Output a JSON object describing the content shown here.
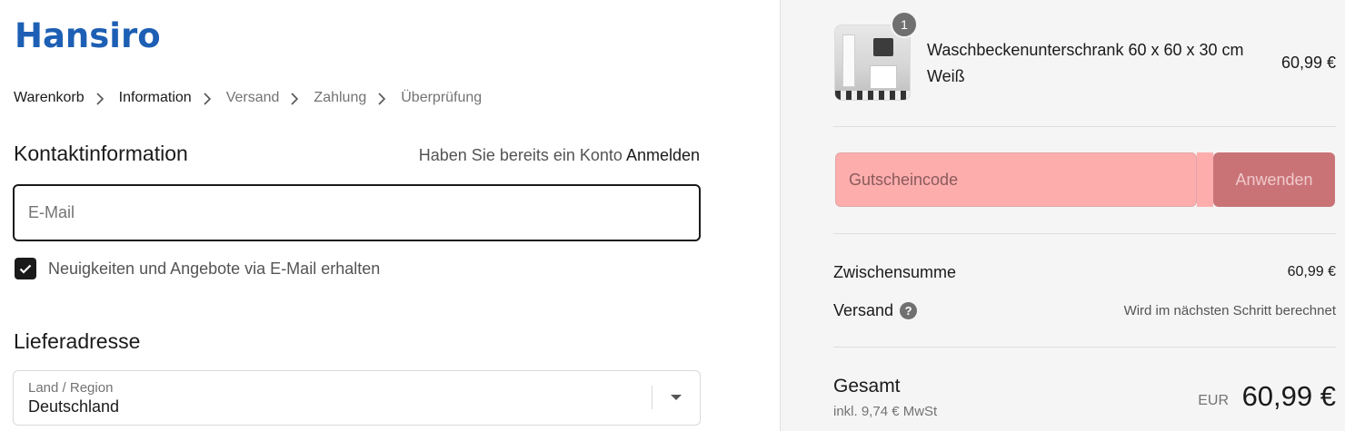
{
  "brand": {
    "logo_text": "Hansiro",
    "color": "#1d5fb4"
  },
  "breadcrumb": {
    "items": [
      {
        "label": "Warenkorb",
        "state": "link"
      },
      {
        "label": "Information",
        "state": "current"
      },
      {
        "label": "Versand",
        "state": "upcoming"
      },
      {
        "label": "Zahlung",
        "state": "upcoming"
      },
      {
        "label": "Überprüfung",
        "state": "upcoming"
      }
    ],
    "separator_icon": "chevron-right-icon"
  },
  "contact": {
    "title": "Kontaktinformation",
    "login_prompt": "Haben Sie bereits ein Konto",
    "login_link": "Anmelden",
    "email": {
      "placeholder": "E-Mail",
      "value": ""
    },
    "newsletter": {
      "label": "Neuigkeiten und Angebote via E-Mail erhalten",
      "checked": true
    }
  },
  "shipping_address": {
    "title": "Lieferadresse",
    "country": {
      "caption": "Land / Region",
      "value": "Deutschland"
    }
  },
  "summary": {
    "product": {
      "name": "Waschbeckenunterschrank 60 x 60 x 30 cm Weiß",
      "quantity": "1",
      "price": "60,99 €"
    },
    "coupon": {
      "placeholder": "Gutscheincode",
      "apply_label": "Anwenden"
    },
    "subtotal": {
      "label": "Zwischensumme",
      "value": "60,99 €"
    },
    "shipping": {
      "label": "Versand",
      "help_icon": "?",
      "value": "Wird im nächsten Schritt berechnet"
    },
    "total": {
      "label": "Gesamt",
      "tax_note": "inkl. 9,74 € MwSt",
      "currency": "EUR",
      "amount": "60,99 €"
    }
  }
}
